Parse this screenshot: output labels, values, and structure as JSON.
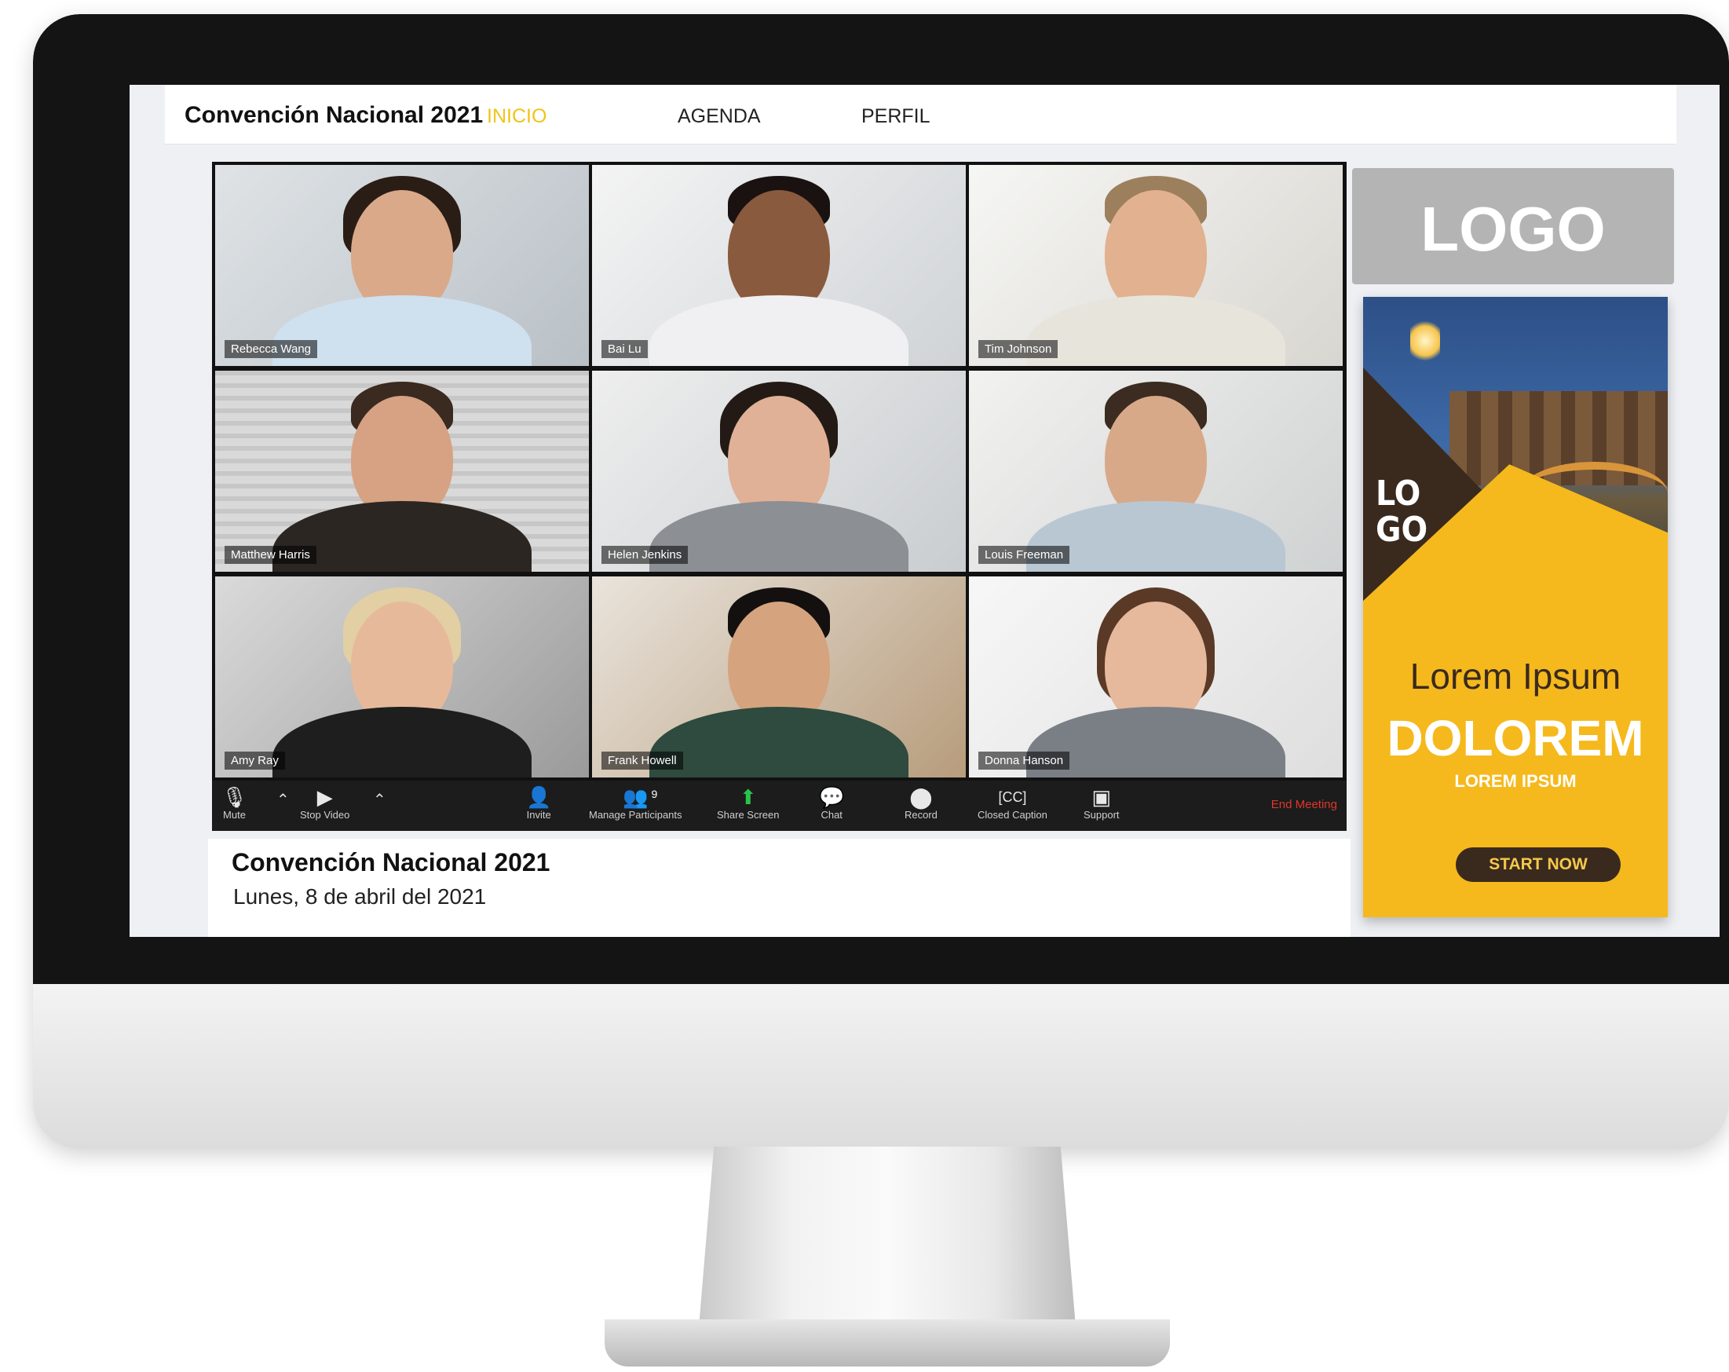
{
  "header": {
    "site_title": "Convención Nacional 2021",
    "nav": [
      {
        "label": "INICIO",
        "active": true
      },
      {
        "label": "AGENDA",
        "active": false
      },
      {
        "label": "PERFIL",
        "active": false
      }
    ]
  },
  "participants": [
    {
      "name": "Rebecca Wang"
    },
    {
      "name": "Bai Lu"
    },
    {
      "name": "Tim Johnson"
    },
    {
      "name": "Matthew Harris"
    },
    {
      "name": "Helen Jenkins"
    },
    {
      "name": "Louis Freeman"
    },
    {
      "name": "Amy Ray"
    },
    {
      "name": "Frank Howell"
    },
    {
      "name": "Donna Hanson"
    }
  ],
  "toolbar": {
    "mute": "Mute",
    "stop_video": "Stop Video",
    "invite": "Invite",
    "manage_participants": "Manage Participants",
    "participant_count": "9",
    "share_screen": "Share Screen",
    "chat": "Chat",
    "record": "Record",
    "closed_caption": "Closed Caption",
    "support": "Support",
    "end_meeting": "End Meeting"
  },
  "event": {
    "title": "Convención Nacional 2021",
    "date": "Lunes, 8 de abril del 2021"
  },
  "sidebar": {
    "logo_text": "LOGO",
    "banner": {
      "logo_text_line1": "LO",
      "logo_text_line2": "GO",
      "headline": "Lorem Ipsum",
      "title": "DOLOREM",
      "subtitle": "LOREM IPSUM",
      "cta": "START NOW"
    }
  },
  "colors": {
    "nav_active": "#f2c318",
    "end_meeting": "#e0362c",
    "banner_yellow": "#f5b91d",
    "banner_dark": "#3a2a1e",
    "share_green": "#2bc24a"
  }
}
